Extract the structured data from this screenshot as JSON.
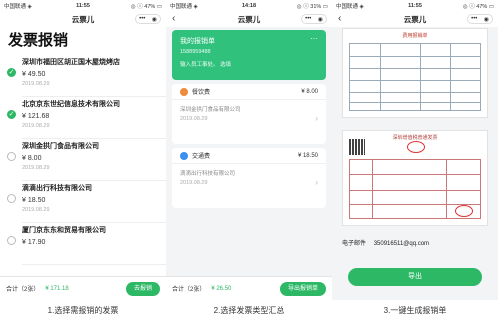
{
  "panel1": {
    "status": {
      "carrier": "中国联通 ◈",
      "time": "11:55",
      "right": "◎ ⓘ 47% ▭"
    },
    "nav_title": "云票儿",
    "heading": "发票报销",
    "rows": [
      {
        "name": "深圳市福田区胡正国木屋烧烤店",
        "amount": "¥ 49.50",
        "date": "2019.08.29",
        "checked": true
      },
      {
        "name": "北京京东世纪信息技术有限公司",
        "amount": "¥ 121.68",
        "date": "2019.08.29",
        "checked": true
      },
      {
        "name": "深圳金拱门食品有限公司",
        "amount": "¥ 8.00",
        "date": "2019.08.29",
        "checked": false
      },
      {
        "name": "滴滴出行科技有限公司",
        "amount": "¥ 18.50",
        "date": "2019.08.29",
        "checked": false
      },
      {
        "name": "厦门京东东和贸易有限公司",
        "amount": "¥ 17.90",
        "date": "",
        "checked": false
      }
    ],
    "total_label": "合计（2张）",
    "total_amount": "¥ 171.18",
    "button": "去报销"
  },
  "panel2": {
    "status": {
      "carrier": "中国联通 ◈",
      "time": "14:18",
      "right": "◎ ⓘ 31% ▭"
    },
    "nav_title": "云票儿",
    "bill_title": "我的报销单",
    "bill_phone": "1588959488",
    "bill_note": "输入员工事处。 选填",
    "categories": [
      {
        "label": "餐饮费",
        "sum": "¥ 8.00",
        "name": "深圳金拱门食品有限公司",
        "date": "2019.08.29",
        "color": "#f08a3c"
      },
      {
        "label": "交通费",
        "sum": "¥ 18.50",
        "name": "滴滴出行科技有限公司",
        "date": "2019.08.29",
        "color": "#3b8ff0"
      }
    ],
    "total_label": "合计（2张）",
    "total_amount": "¥ 26.50",
    "button": "导出报销单"
  },
  "panel3": {
    "status": {
      "carrier": "中国联通 ◈",
      "time": "11:55",
      "right": "◎ ⓘ 47% ▭"
    },
    "nav_title": "云票儿",
    "doc1_title": "费用报销单",
    "doc2_title": "深圳增值税普通发票",
    "email_label": "电子邮件",
    "email_value": "350916511@qq.com",
    "button": "导出"
  },
  "captions": [
    "1.选择需报销的发票",
    "2.选择发票类型汇总",
    "3.一键生成报销单"
  ],
  "colors": {
    "brand_green": "#2db866",
    "bill_green": "#30c27d",
    "stamp_red": "#d33333"
  }
}
